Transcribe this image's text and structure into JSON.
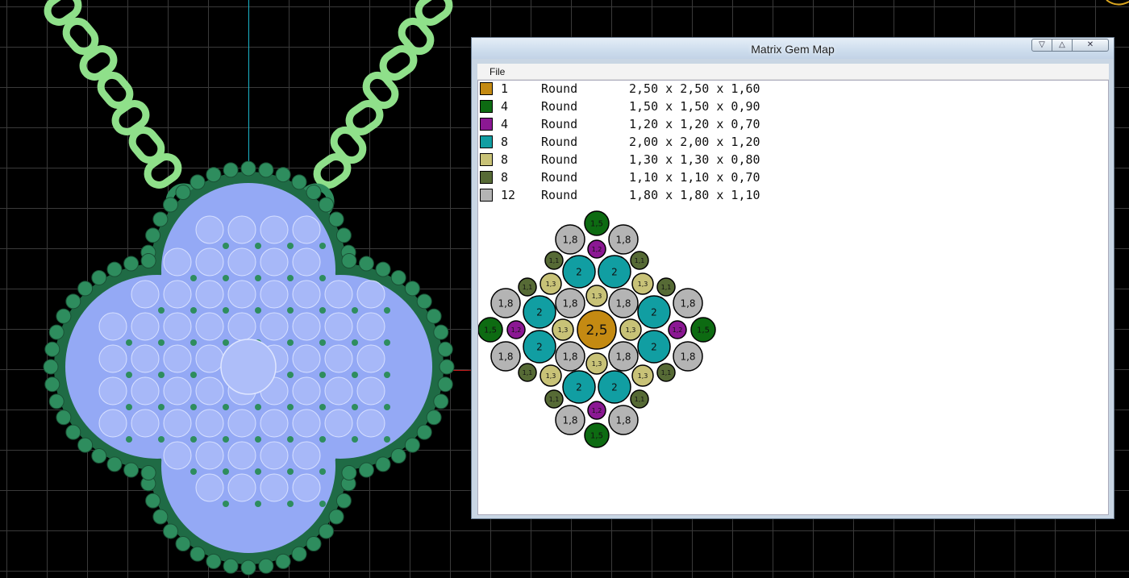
{
  "window": {
    "title": "Matrix Gem Map",
    "menu": {
      "file_label": "File"
    }
  },
  "legend": [
    {
      "count": "1",
      "shape": "Round",
      "dims": "2,50 x 2,50 x 1,60",
      "color": "#c48a12"
    },
    {
      "count": "4",
      "shape": "Round",
      "dims": "1,50 x 1,50 x 0,90",
      "color": "#0d6b12"
    },
    {
      "count": "4",
      "shape": "Round",
      "dims": "1,20 x 1,20 x 0,70",
      "color": "#8b1893"
    },
    {
      "count": "8",
      "shape": "Round",
      "dims": "2,00 x 2,00 x 1,20",
      "color": "#119ea2"
    },
    {
      "count": "8",
      "shape": "Round",
      "dims": "1,30 x 1,30 x 0,80",
      "color": "#c8c277"
    },
    {
      "count": "8",
      "shape": "Round",
      "dims": "1,10 x 1,10 x 0,70",
      "color": "#566a35"
    },
    {
      "count": "12",
      "shape": "Round",
      "dims": "1,80 x 1,80 x 1,10",
      "color": "#b4b4b4"
    }
  ],
  "gem_map": {
    "stones": [
      {
        "label": "2,5",
        "color": "#c48a12"
      },
      {
        "label": "1,5",
        "color": "#0d6b12"
      },
      {
        "label": "1,2",
        "color": "#8b1893"
      },
      {
        "label": "2",
        "color": "#119ea2"
      },
      {
        "label": "1,3",
        "color": "#c8c277"
      },
      {
        "label": "1,1",
        "color": "#566a35"
      },
      {
        "label": "1,8",
        "color": "#b4b4b4"
      }
    ]
  },
  "colors": {
    "viewport_bg": "#000000",
    "grid": "#3a3a3a",
    "chain": "#8fe08a",
    "pendant_metal": "#2e8d5e",
    "pendant_stone": "#94a9f5"
  }
}
